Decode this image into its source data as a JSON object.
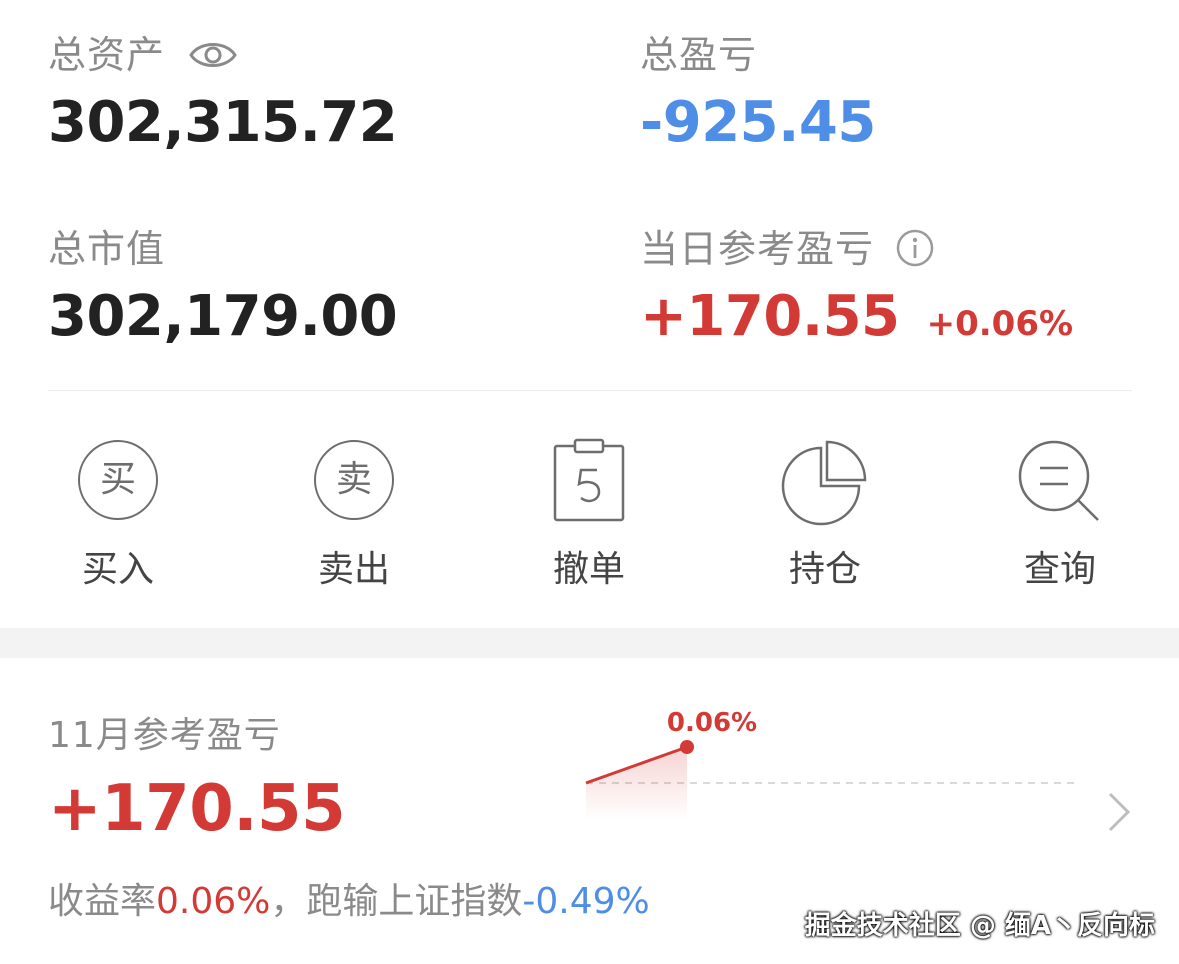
{
  "summary": {
    "total_assets_label": "总资产",
    "total_assets_value": "302,315.72",
    "total_pnl_label": "总盈亏",
    "total_pnl_value": "-925.45",
    "market_value_label": "总市值",
    "market_value_value": "302,179.00",
    "daily_pnl_label": "当日参考盈亏",
    "daily_pnl_value": "+170.55",
    "daily_pnl_percent": "+0.06%"
  },
  "actions": [
    {
      "label": "买入",
      "glyph": "买"
    },
    {
      "label": "卖出",
      "glyph": "卖"
    },
    {
      "label": "撤单"
    },
    {
      "label": "持仓"
    },
    {
      "label": "查询"
    }
  ],
  "monthly": {
    "label": "11月参考盈亏",
    "value": "+170.55",
    "yield_label": "收益率",
    "yield_value": "0.06%",
    "compare_label": "，跑输上证指数",
    "compare_value": "-0.49%"
  },
  "chart_data": {
    "type": "line",
    "x": [
      0,
      1
    ],
    "values": [
      0,
      0.06
    ],
    "point_labels": [
      "",
      "0.06%"
    ],
    "baseline": 0,
    "color": "#d33a36"
  },
  "colors": {
    "red": "#d33a36",
    "blue": "#4f8ee6",
    "gray": "#8a8a8a"
  },
  "icons": [
    "eye-icon",
    "info-icon",
    "revoke-icon",
    "pie-chart-icon",
    "search-icon",
    "chevron-right-icon"
  ],
  "watermark": "掘金技术社区 @ 缅A丶反向标"
}
